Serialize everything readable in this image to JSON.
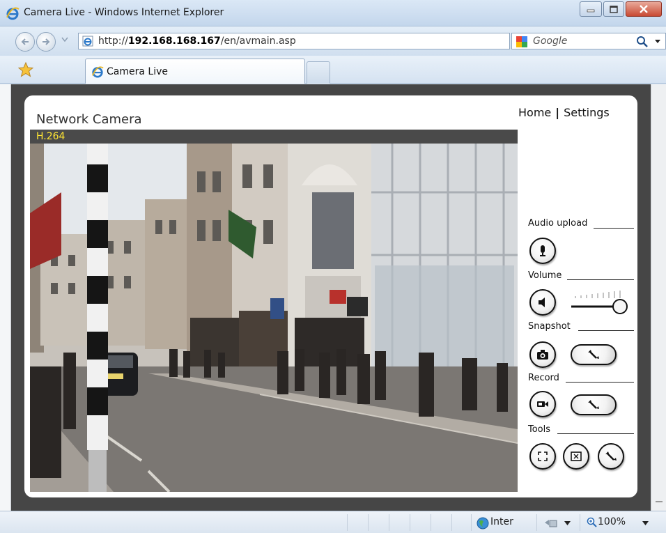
{
  "window": {
    "title": "Camera Live - Windows Internet Explorer"
  },
  "address_bar": {
    "url_prefix": "http://",
    "url_host": "192.168.168.167",
    "url_path": "/en/avmain.asp",
    "search_placeholder": "Google"
  },
  "tabs": [
    {
      "label": "Camera Live"
    }
  ],
  "camera_page": {
    "title": "Network Camera",
    "nav": {
      "home": "Home",
      "separator": "|",
      "settings": "Settings"
    },
    "codec": "H.264",
    "sections": {
      "audio_upload": "Audio upload",
      "volume": "Volume",
      "snapshot": "Snapshot",
      "record": "Record",
      "tools": "Tools"
    },
    "volume_level": 1.0
  },
  "status_bar": {
    "zone": "Inter",
    "zoom": "100%"
  },
  "colors": {
    "codec_text": "#ffe533",
    "viewport_bg": "#464646",
    "panel_bg": "#ffffff"
  },
  "icons": {
    "audio_upload": "microphone-icon",
    "volume": "speaker-icon",
    "snapshot": "camera-icon",
    "record": "video-camera-icon",
    "settings": "wrench-icon",
    "fullscreen": "fullscreen-icon",
    "digital_zoom": "zoom-frame-icon"
  }
}
